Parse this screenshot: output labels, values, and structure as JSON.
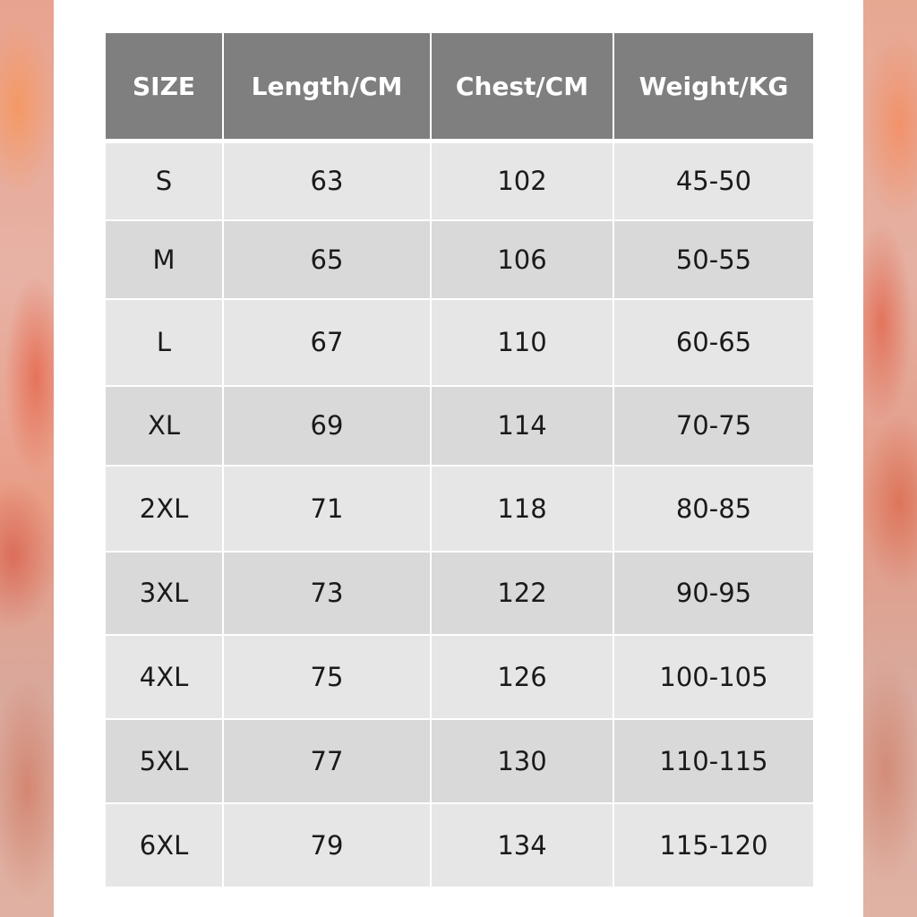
{
  "table": {
    "headers": [
      "SIZE",
      "Length/CM",
      "Chest/CM",
      "Weight/KG"
    ],
    "rows": [
      [
        "S",
        "63",
        "102",
        "45-50"
      ],
      [
        "M",
        "65",
        "106",
        "50-55"
      ],
      [
        "L",
        "67",
        "110",
        "60-65"
      ],
      [
        "XL",
        "69",
        "114",
        "70-75"
      ],
      [
        "2XL",
        "71",
        "118",
        "80-85"
      ],
      [
        "3XL",
        "73",
        "122",
        "90-95"
      ],
      [
        "4XL",
        "75",
        "126",
        "100-105"
      ],
      [
        "5XL",
        "77",
        "130",
        "110-115"
      ],
      [
        "6XL",
        "79",
        "134",
        "115-120"
      ]
    ]
  },
  "colors": {
    "header_bg": "#7f7f7f",
    "header_text": "#ffffff",
    "row_light": "#e6e6e6",
    "row_dark": "#d9d9d9",
    "background_accent": "#e89d86"
  }
}
